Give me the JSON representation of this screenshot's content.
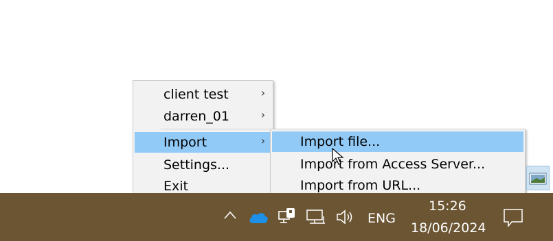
{
  "context_menu": {
    "items": [
      {
        "label": "client test",
        "arrow": "›"
      },
      {
        "label": "darren_01",
        "arrow": "›"
      },
      {
        "label": "Import",
        "arrow": "›"
      },
      {
        "label": "Settings..."
      },
      {
        "label": "Exit"
      }
    ]
  },
  "submenu": {
    "items": [
      {
        "label": "Import file..."
      },
      {
        "label": "Import from Access Server..."
      },
      {
        "label": "Import from URL..."
      }
    ]
  },
  "taskbar": {
    "language": "ENG",
    "time": "15:26",
    "date": "18/06/2024",
    "icons": [
      "chevron-up-icon",
      "onedrive-cloud-icon",
      "vpn-network-icon",
      "network-icon",
      "volume-icon",
      "notification-icon"
    ]
  },
  "colors": {
    "menu_bg": "#f2f2f2",
    "highlight": "#91c9f7",
    "taskbar": "#6b5533"
  }
}
